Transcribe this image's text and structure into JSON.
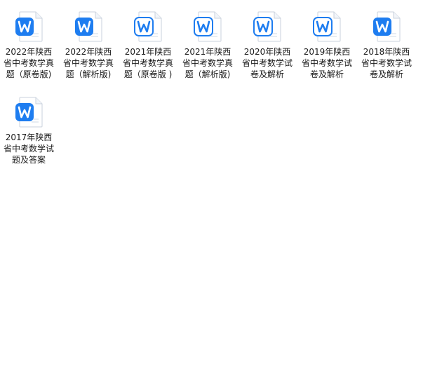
{
  "explorer": {
    "files": [
      {
        "name": "2022年陕西省中考数学真题（原卷版)",
        "icon": "wps-writer-doc-icon",
        "variant": "solid"
      },
      {
        "name": "2022年陕西省中考数学真题（解析版)",
        "icon": "wps-writer-doc-icon",
        "variant": "solid"
      },
      {
        "name": "2021年陕西省中考数学真题（原卷版 )",
        "icon": "wps-writer-doc-icon",
        "variant": "outline"
      },
      {
        "name": "2021年陕西省中考数学真题（解析版)",
        "icon": "wps-writer-doc-icon",
        "variant": "outline"
      },
      {
        "name": "2020年陕西省中考数学试卷及解析",
        "icon": "wps-writer-doc-icon",
        "variant": "outline"
      },
      {
        "name": "2019年陕西省中考数学试卷及解析",
        "icon": "wps-writer-doc-icon",
        "variant": "outline"
      },
      {
        "name": "2018年陕西省中考数学试卷及解析",
        "icon": "wps-writer-doc-icon",
        "variant": "solid"
      },
      {
        "name": "2017年陕西省中考数学试题及答案",
        "icon": "wps-writer-doc-icon",
        "variant": "solid"
      }
    ]
  },
  "colors": {
    "accent": "#1e7df0",
    "accent_light": "#5aa8ff",
    "page_border": "#c9d1dc"
  }
}
